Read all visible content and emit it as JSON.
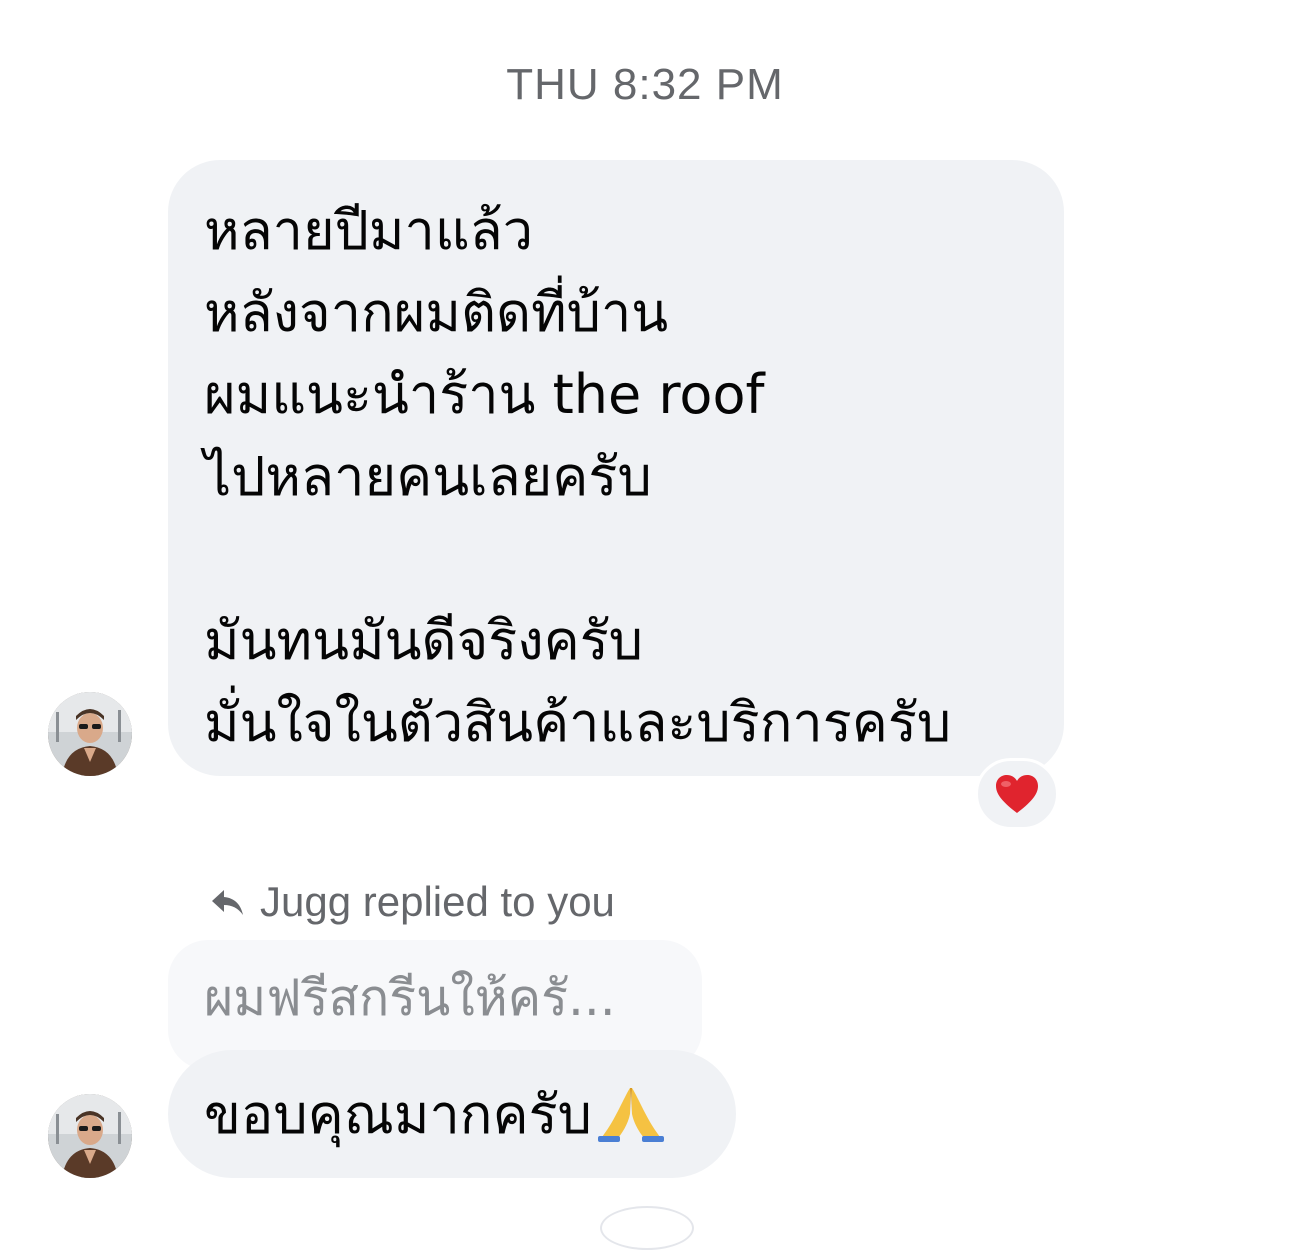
{
  "timestamp": "THU 8:32 PM",
  "message_main": {
    "lines": [
      "หลายปีมาแล้ว",
      "หลังจากผมติดที่บ้าน",
      "ผมแนะนำร้าน the roof",
      "ไปหลายคนเลยครับ",
      "",
      "มันทนมันดีจริงครับ",
      "มั่นใจในตัวสินค้าและบริการครับ"
    ],
    "reaction": "heart-emoji"
  },
  "reply": {
    "label": "Jugg replied to you",
    "quoted_text": "ผมฟรีสกรีนให้ครั...",
    "text": "ขอบคุณมากครับ",
    "emoji": "folded-hands-emoji"
  },
  "colors": {
    "bubble_bg": "#f0f2f5",
    "meta_text": "#65676b",
    "heart": "#e0242e"
  }
}
